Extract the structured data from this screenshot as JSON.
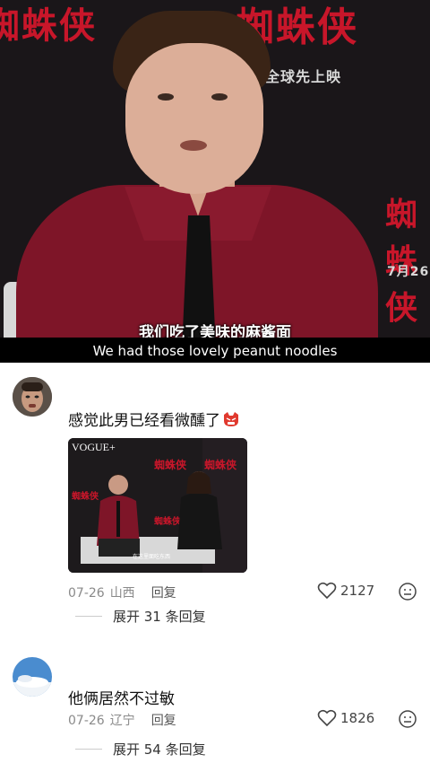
{
  "video": {
    "subtitle_cn": "我们吃了美味的麻酱面",
    "subtitle_en": "We had those lovely peanut noodles",
    "poster_text": "蜘蛛侠",
    "poster_sub": "全球先上映",
    "poster_sub2": "7月26"
  },
  "comments": [
    {
      "text": "感觉此男已经看微醺了",
      "emoji_icon": "angry-face-icon",
      "image": {
        "brand": "VOGUE+",
        "poster_text": "蜘蛛侠",
        "caption": "在这里面吃东西"
      },
      "date": "07-26",
      "location": "山西",
      "reply_label": "回复",
      "likes": "2127",
      "expand_label": "展开 31 条回复"
    },
    {
      "text": "他俩居然不过敏",
      "date": "07-26",
      "location": "辽宁",
      "reply_label": "回复",
      "likes": "1826",
      "expand_label": "展开 54 条回复"
    }
  ],
  "colors": {
    "accent": "#c8162a",
    "shirt": "#7e1528",
    "meta": "#8a8a8a"
  }
}
